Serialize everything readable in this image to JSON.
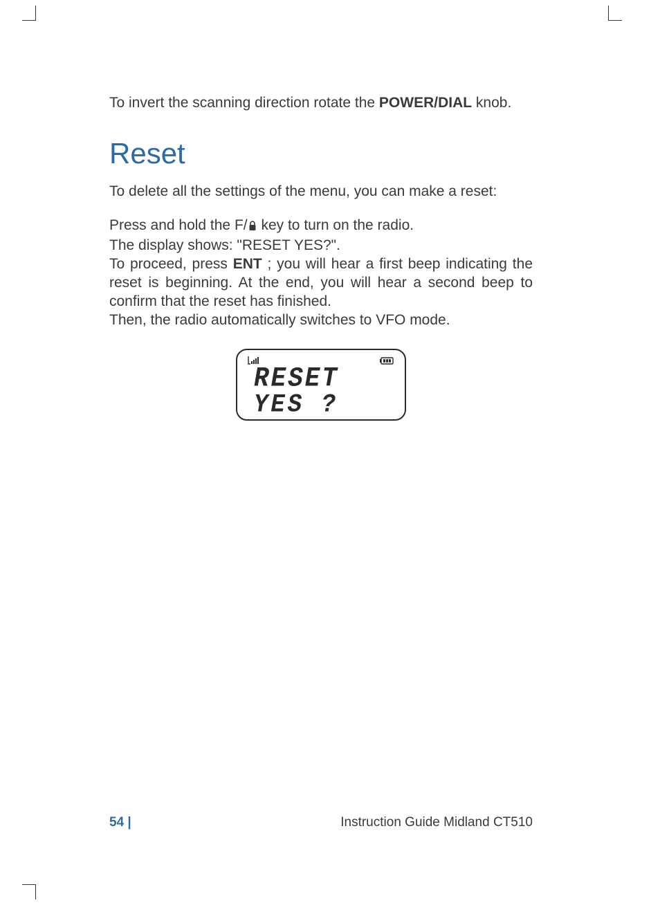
{
  "intro": {
    "text_before": "To invert the scanning direction rotate the ",
    "bold": "POWER/DIAL",
    "text_after": " knob."
  },
  "heading": "Reset",
  "para_delete": "To delete all the settings of the menu, you can make a reset:",
  "instruction": {
    "line1_before_icon": "Press and hold the F/",
    "line1_after_icon": " key to turn on the radio.",
    "line2": "The display shows: \"RESET YES?\".",
    "line3_before_bold": "To proceed, press ",
    "line3_bold": "ENT",
    "line3_after_bold": " ; you will hear a first beep indicating the reset is beginning. At the end, you will hear a second beep to confirm that the reset has finished.",
    "line4": "Then, the radio automatically switches to VFO mode."
  },
  "lcd": {
    "line1": "RESET",
    "line2": "YES ?"
  },
  "footer": {
    "page_number": "54 |",
    "title": "Instruction Guide Midland CT510"
  },
  "icons": {
    "lock": "lock-icon",
    "signal": "signal-icon",
    "battery": "battery-icon"
  }
}
